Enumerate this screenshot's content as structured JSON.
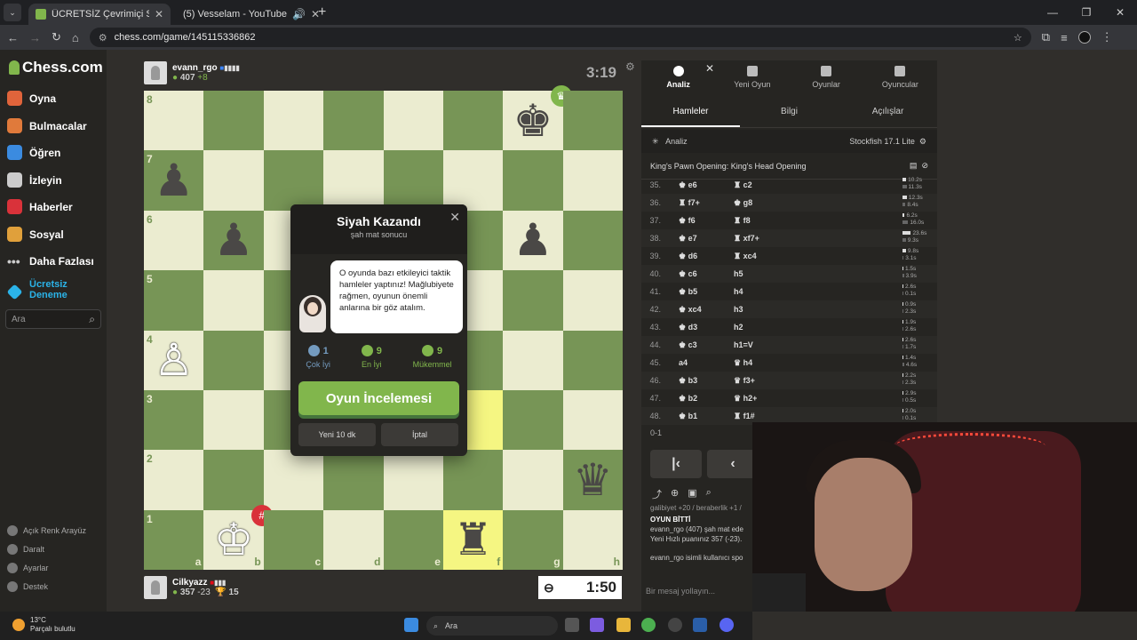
{
  "browser": {
    "tabs": [
      {
        "title": "ÜCRETSİZ Çevrimiçi Satranç Oy",
        "color": "#81b64c"
      },
      {
        "title": "(5) Vesselam - YouTube",
        "color": "#ff0000"
      }
    ],
    "url": "chess.com/game/145115336862"
  },
  "sidebar": {
    "logo": "Chess.com",
    "items": [
      {
        "label": "Oyna",
        "color": "#e0643b"
      },
      {
        "label": "Bulmacalar",
        "color": "#e07a3b"
      },
      {
        "label": "Öğren",
        "color": "#3b8be0"
      },
      {
        "label": "İzleyin",
        "color": "#cccccc"
      },
      {
        "label": "Haberler",
        "color": "#d9323a"
      },
      {
        "label": "Sosyal",
        "color": "#e0a03b"
      },
      {
        "label": "Daha Fazlası",
        "color": "#cccccc"
      },
      {
        "label": "Ücretsiz Deneme",
        "color": "#2bb3e8"
      }
    ],
    "search_placeholder": "Ara",
    "bottom": [
      "Açık Renk Arayüz",
      "Daralt",
      "Ayarlar",
      "Destek"
    ]
  },
  "top_player": {
    "name": "evann_rgo",
    "rating": "407",
    "delta": "+8",
    "clock": "3:19"
  },
  "bottom_player": {
    "name": "Cilkyazz",
    "rating": "357",
    "delta": "-23",
    "trophies": "15",
    "clock": "1:50"
  },
  "board": {
    "ranks": [
      "8",
      "7",
      "6",
      "5",
      "4",
      "3",
      "2",
      "1"
    ],
    "files": [
      "a",
      "b",
      "c",
      "d",
      "e",
      "f",
      "g",
      "h"
    ],
    "pieces": [
      {
        "sq": "g8",
        "glyph": "♚",
        "color": "black",
        "badge": "winner"
      },
      {
        "sq": "a7",
        "glyph": "♟",
        "color": "black"
      },
      {
        "sq": "b6",
        "glyph": "♟",
        "color": "black"
      },
      {
        "sq": "g6",
        "glyph": "♟",
        "color": "black"
      },
      {
        "sq": "a4",
        "glyph": "♙",
        "color": "white"
      },
      {
        "sq": "h2",
        "glyph": "♛",
        "color": "black"
      },
      {
        "sq": "b1",
        "glyph": "♔",
        "color": "white",
        "badge": "mated"
      },
      {
        "sq": "f1",
        "glyph": "♜",
        "color": "black"
      }
    ],
    "highlight": [
      "f3",
      "f1"
    ]
  },
  "modal": {
    "title": "Siyah Kazandı",
    "subtitle": "şah mat sonucu",
    "coach_text": "O oyunda bazı etkileyici taktik hamleler yaptınız! Mağlubiyete rağmen, oyunun önemli anlarına bir göz atalım.",
    "stats": [
      {
        "value": "1",
        "label": "Çok İyi",
        "color": "#749bbf"
      },
      {
        "value": "9",
        "label": "En İyi",
        "color": "#81b64c"
      },
      {
        "value": "9",
        "label": "Mükemmel",
        "color": "#81b64c"
      }
    ],
    "review_button": "Oyun İncelemesi",
    "new_game_button": "Yeni 10 dk",
    "cancel_button": "İptal"
  },
  "panel": {
    "tabs": [
      "Analiz",
      "Yeni Oyun",
      "Oyunlar",
      "Oyuncular"
    ],
    "subtabs": [
      "Hamleler",
      "Bilgi",
      "Açılışlar"
    ],
    "analysis_label": "Analiz",
    "engine": "Stockfish 17.1 Lite",
    "opening": "King's Pawn Opening: King's Head Opening",
    "moves": [
      {
        "n": "35.",
        "w": "e6",
        "wp": "♚",
        "b": "c2",
        "bp": "♜",
        "tw": "10.2s",
        "tb": "11.3s"
      },
      {
        "n": "36.",
        "w": "f7+",
        "wp": "♜",
        "b": "g8",
        "bp": "♚",
        "tw": "12.3s",
        "tb": "8.4s"
      },
      {
        "n": "37.",
        "w": "f6",
        "wp": "♚",
        "b": "f8",
        "bp": "♜",
        "tw": "6.2s",
        "tb": "16.0s"
      },
      {
        "n": "38.",
        "w": "e7",
        "wp": "♚",
        "b": "xf7+",
        "bp": "♜",
        "tw": "23.6s",
        "tb": "9.3s"
      },
      {
        "n": "39.",
        "w": "d6",
        "wp": "♚",
        "b": "xc4",
        "bp": "♜",
        "tw": "9.8s",
        "tb": "3.1s"
      },
      {
        "n": "40.",
        "w": "c6",
        "wp": "♚",
        "b": "h5",
        "bp": "",
        "tw": "1.5s",
        "tb": "3.9s"
      },
      {
        "n": "41.",
        "w": "b5",
        "wp": "♚",
        "b": "h4",
        "bp": "",
        "tw": "2.6s",
        "tb": "0.1s"
      },
      {
        "n": "42.",
        "w": "xc4",
        "wp": "♚",
        "b": "h3",
        "bp": "",
        "tw": "0.9s",
        "tb": "2.3s"
      },
      {
        "n": "43.",
        "w": "d3",
        "wp": "♚",
        "b": "h2",
        "bp": "",
        "tw": "1.9s",
        "tb": "2.6s"
      },
      {
        "n": "44.",
        "w": "c3",
        "wp": "♚",
        "b": "h1=V",
        "bp": "",
        "tw": "2.6s",
        "tb": "1.7s"
      },
      {
        "n": "45.",
        "w": "a4",
        "wp": "",
        "b": "h4",
        "bp": "♛",
        "tw": "1.4s",
        "tb": "4.6s"
      },
      {
        "n": "46.",
        "w": "b3",
        "wp": "♚",
        "b": "f3+",
        "bp": "♛",
        "tw": "2.2s",
        "tb": "2.3s"
      },
      {
        "n": "47.",
        "w": "b2",
        "wp": "♚",
        "b": "h2+",
        "bp": "♛",
        "tw": "2.9s",
        "tb": "0.5s"
      },
      {
        "n": "48.",
        "w": "b1",
        "wp": "♚",
        "b": "f1#",
        "bp": "♜",
        "tw": "2.0s",
        "tb": "0.1s"
      }
    ],
    "result": "0-1",
    "chat": {
      "line0": "galibiyet +20 / beraberlik +1 /",
      "heading": "OYUN BİTTİ",
      "line1": "evann_rgo (407) şah mat ede",
      "line2": "Yeni Hızlı puanınız 357 (-23).",
      "line3": "evann_rgo isimli kullanıcı spo"
    },
    "chat_placeholder": "Bir mesaj yollayın..."
  },
  "taskbar": {
    "temperature": "13°C",
    "weather": "Parçalı bulutlu",
    "search": "Ara"
  }
}
